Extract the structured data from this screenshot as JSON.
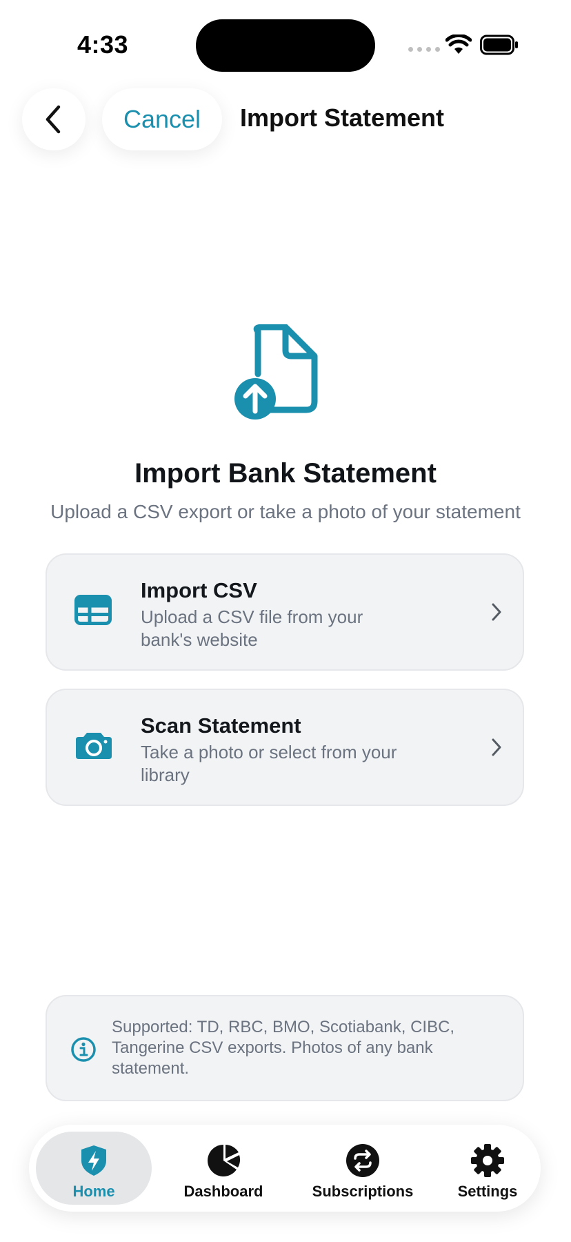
{
  "status_bar": {
    "time": "4:33"
  },
  "nav": {
    "cancel_label": "Cancel",
    "title": "Import Statement"
  },
  "hero": {
    "title": "Import Bank Statement",
    "subtitle": "Upload a CSV export or take a photo of your statement"
  },
  "options": [
    {
      "title": "Import CSV",
      "description": "Upload a CSV file from your bank's website",
      "icon": "table-icon"
    },
    {
      "title": "Scan Statement",
      "description": "Take a photo or select from your library",
      "icon": "camera-icon"
    }
  ],
  "info": {
    "text": "Supported: TD, RBC, BMO, Scotiabank, CIBC, Tangerine CSV exports. Photos of any bank statement.",
    "icon": "info-icon"
  },
  "tabs": [
    {
      "label": "Home",
      "icon": "shield-bolt-icon",
      "active": true
    },
    {
      "label": "Dashboard",
      "icon": "pie-chart-icon",
      "active": false
    },
    {
      "label": "Subscriptions",
      "icon": "repeat-icon",
      "active": false
    },
    {
      "label": "Settings",
      "icon": "gear-icon",
      "active": false
    }
  ],
  "colors": {
    "accent": "#1a8fae",
    "card_bg": "#f2f3f5",
    "muted_text": "#6b7380"
  }
}
